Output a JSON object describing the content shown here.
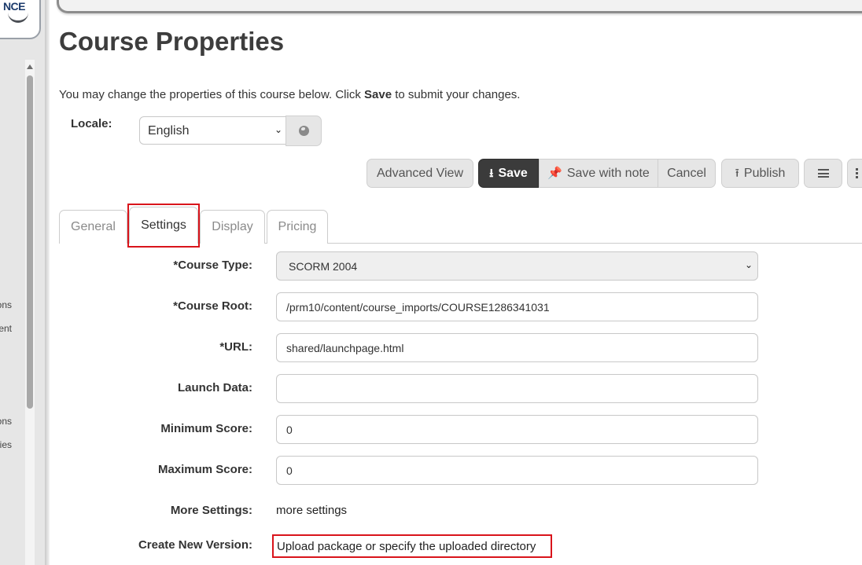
{
  "sidebar": {
    "logo_text": "NCE",
    "items": [
      {
        "label": "ons"
      },
      {
        "label": "ent"
      },
      {
        "label": "ons"
      },
      {
        "label": "ies"
      }
    ]
  },
  "page": {
    "title": "Course Properties",
    "intro_prefix": "You may change the properties of this course below. Click",
    "intro_bold": "Save",
    "intro_suffix": "to submit your changes."
  },
  "locale": {
    "label": "Locale:",
    "selected": "English",
    "globe_icon": "globe-icon"
  },
  "toolbar": {
    "advanced_view": "Advanced View",
    "save": "Save",
    "save_with_note": "Save with note",
    "cancel": "Cancel",
    "publish": "Publish"
  },
  "tabs": [
    {
      "label": "General"
    },
    {
      "label": "Settings"
    },
    {
      "label": "Display"
    },
    {
      "label": "Pricing"
    }
  ],
  "form": {
    "course_type": {
      "label": "*Course Type:",
      "value": "SCORM 2004"
    },
    "course_root": {
      "label": "*Course Root:",
      "value": "/prm10/content/course_imports/COURSE1286341031"
    },
    "url": {
      "label": "*URL:",
      "value": "shared/launchpage.html"
    },
    "launch_data": {
      "label": "Launch Data:",
      "value": ""
    },
    "minimum_score": {
      "label": "Minimum Score:",
      "value": "0"
    },
    "maximum_score": {
      "label": "Maximum Score:",
      "value": "0"
    },
    "more_settings": {
      "label": "More Settings:",
      "value": "more settings"
    },
    "create_new_version": {
      "label": "Create New Version:",
      "value": "Upload package or specify the uploaded directory"
    }
  },
  "colors": {
    "accent_dark": "#3b3b3b",
    "highlight_red": "#d9141b",
    "button_gray": "#e6e6e6"
  }
}
